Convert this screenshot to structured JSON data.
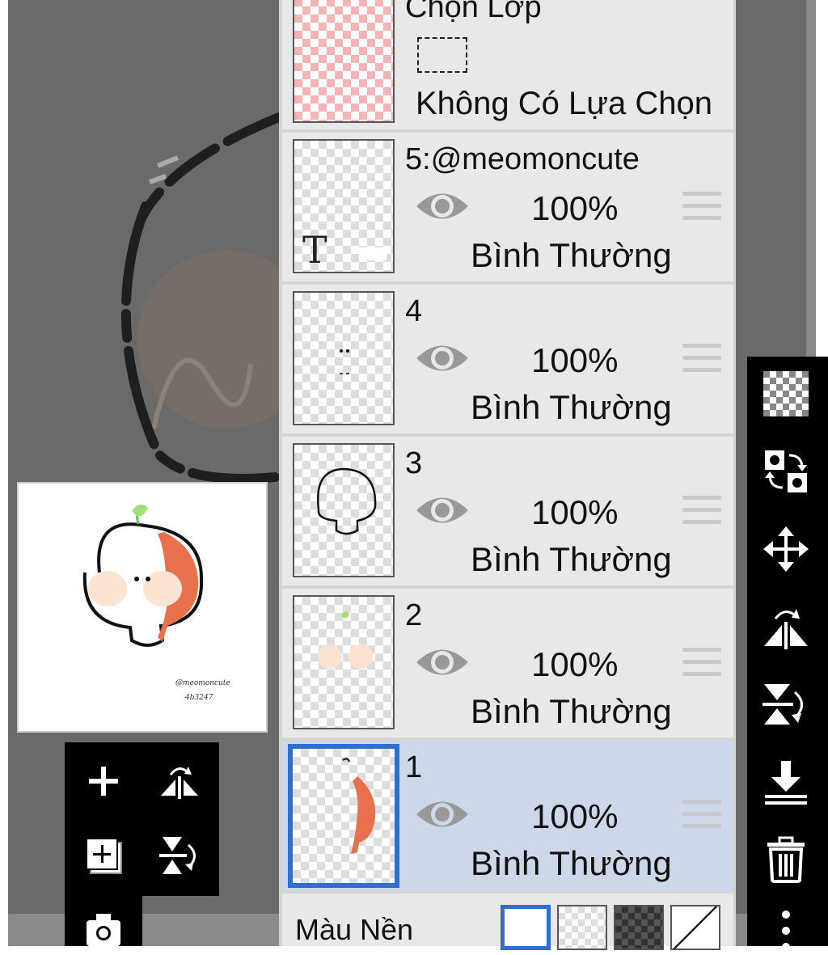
{
  "layer_panel": {
    "selection_layer": {
      "title": "Chọn Lớp",
      "status": "Không Có Lựa Chọn"
    },
    "layers": [
      {
        "name": "5:@meomoncute",
        "opacity": "100%",
        "blend": "Bình Thường",
        "visible": true,
        "selected": false,
        "thumb_text": "T"
      },
      {
        "name": "4",
        "opacity": "100%",
        "blend": "Bình Thường",
        "visible": true,
        "selected": false
      },
      {
        "name": "3",
        "opacity": "100%",
        "blend": "Bình Thường",
        "visible": true,
        "selected": false
      },
      {
        "name": "2",
        "opacity": "100%",
        "blend": "Bình Thường",
        "visible": true,
        "selected": false
      },
      {
        "name": "1",
        "opacity": "100%",
        "blend": "Bình Thường",
        "visible": true,
        "selected": true
      }
    ],
    "background": {
      "label": "Màu Nền",
      "options": [
        "white",
        "transparent",
        "dark-checker",
        "diagonal"
      ]
    }
  },
  "preview": {
    "watermark_name": "@meomoncute",
    "watermark_id": "4b3247"
  },
  "colors": {
    "selection_accent": "#2f6fd0",
    "selected_row": "#ccd7ea",
    "orange": "#e9704d",
    "peach": "#fbe4d2",
    "leaf_green": "#9fe07a"
  },
  "left_tools": [
    "add-layer-icon",
    "flip-horizontal-icon",
    "add-copy-layer-icon",
    "flip-vertical-icon",
    "camera-icon"
  ],
  "right_tools": [
    "transparency-icon",
    "swap-icon",
    "move-icon",
    "flip-horizontal-icon",
    "flip-vertical-icon",
    "merge-down-icon",
    "delete-icon",
    "more-icon"
  ]
}
